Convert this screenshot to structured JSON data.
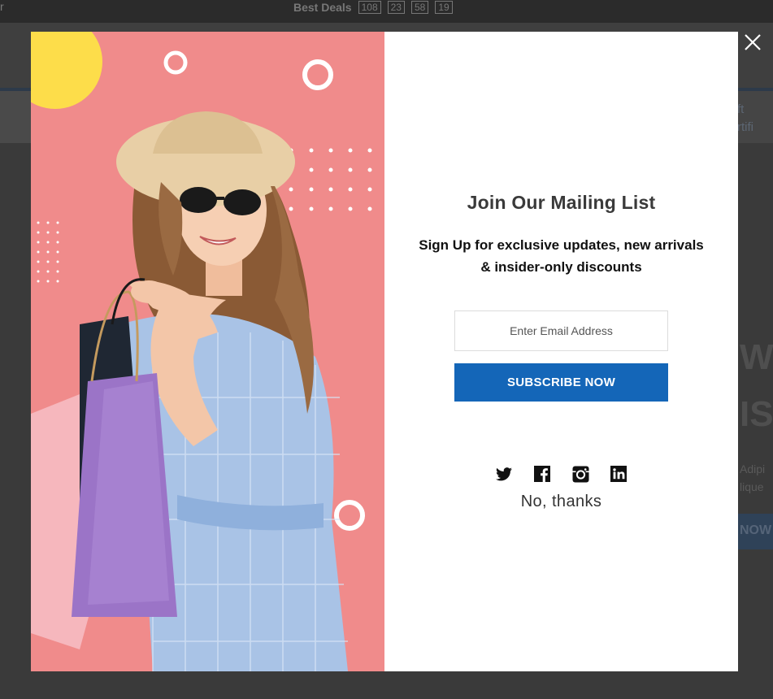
{
  "background": {
    "topbar_edge": "r",
    "deals_label": "Best Deals",
    "countdown": [
      "108",
      "23",
      "58",
      "19"
    ],
    "gift_text": "ft\nrtifi",
    "hero_w": "W",
    "hero_is": "IS",
    "hero_small": "Adipi\nlique",
    "hero_btn": "NOW"
  },
  "modal": {
    "title": "Join Our Mailing List",
    "subtitle": "Sign Up for exclusive updates, new arrivals & insider-only discounts",
    "email_placeholder": "Enter Email Address",
    "subscribe_label": "SUBSCRIBE NOW",
    "dismiss_label": "No, thanks",
    "socials": [
      "twitter-icon",
      "facebook-icon",
      "instagram-icon",
      "linkedin-icon"
    ],
    "accent_color": "#1466b8",
    "image_bg_color": "#f08b8b"
  }
}
